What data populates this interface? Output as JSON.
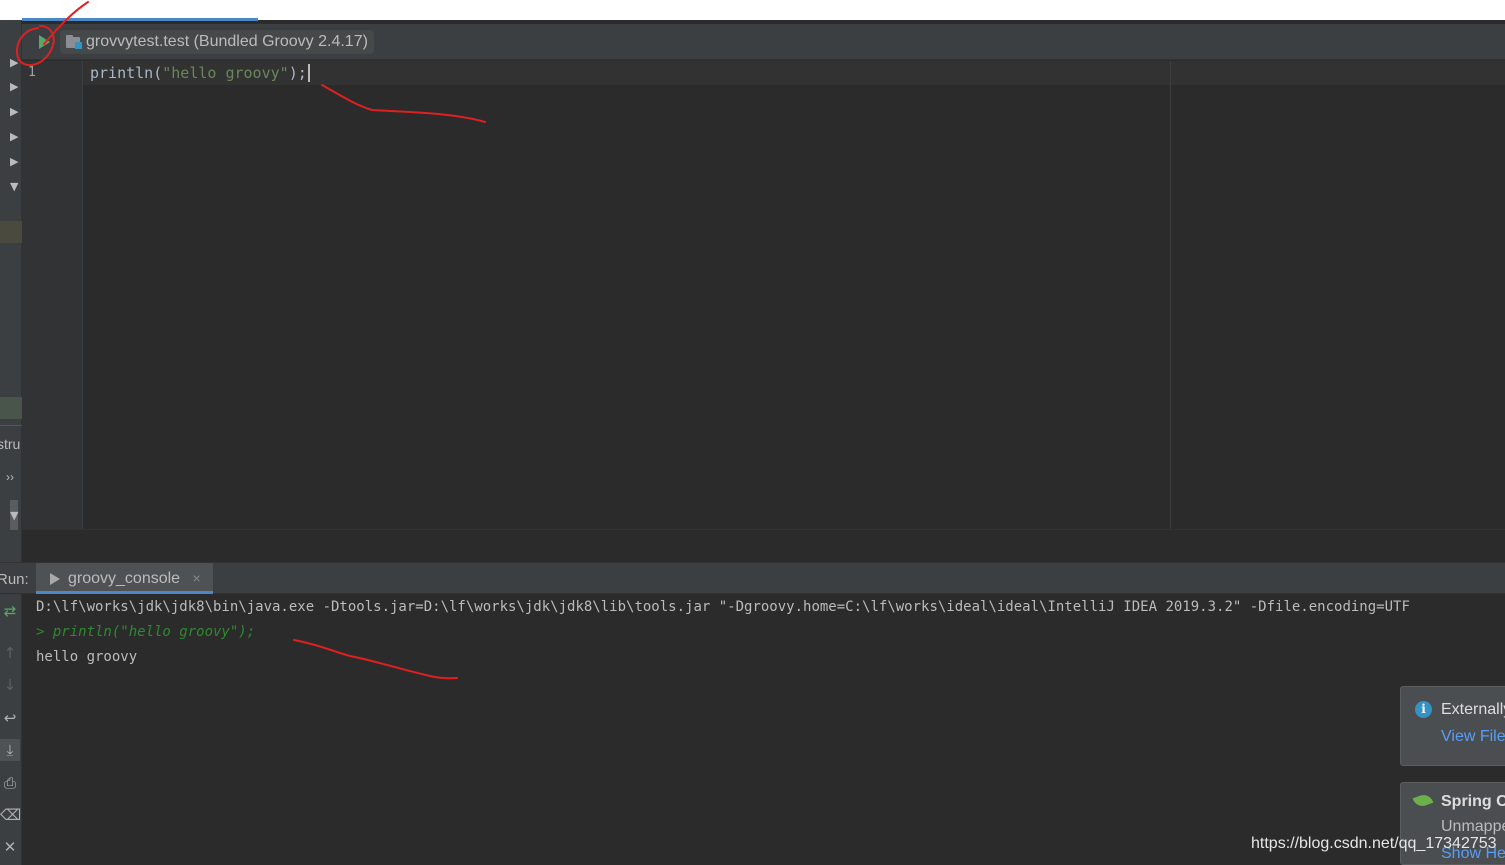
{
  "editor": {
    "config_label": "grovvytest.test (Bundled Groovy 2.4.17)",
    "line_number": "1",
    "code": {
      "fn": "println(",
      "str": "\"hello groovy\"",
      "tail": ");"
    }
  },
  "side": {
    "structure_label": "stru",
    "more": "››"
  },
  "run_panel": {
    "label": "Run:",
    "tab_label": "groovy_console",
    "tab_close": "×"
  },
  "console": {
    "command_line": "D:\\lf\\works\\jdk\\jdk8\\bin\\java.exe -Dtools.jar=D:\\lf\\works\\jdk\\jdk8\\lib\\tools.jar \"-Dgroovy.home=C:\\lf\\works\\ideal\\ideal\\IntelliJ IDEA 2019.3.2\" -Dfile.encoding=UTF",
    "echo_line": "> println(\"hello groovy\");",
    "output_line": "hello groovy"
  },
  "notifications": [
    {
      "title": "Externally",
      "link": "View File"
    },
    {
      "title": "Spring C",
      "body": "Unmapped",
      "link": "Show He"
    }
  ],
  "icons": {
    "run": "run-icon",
    "folder": "folder-icon",
    "info": "info-icon",
    "spring": "spring-leaf-icon"
  },
  "colors": {
    "background": "#2b2b2b",
    "panel": "#3c3f41",
    "string": "#6a8759",
    "run_green": "#59a869",
    "link": "#589df6",
    "annotation": "#e02020"
  },
  "watermark": "https://blog.csdn.net/qq_17342753"
}
